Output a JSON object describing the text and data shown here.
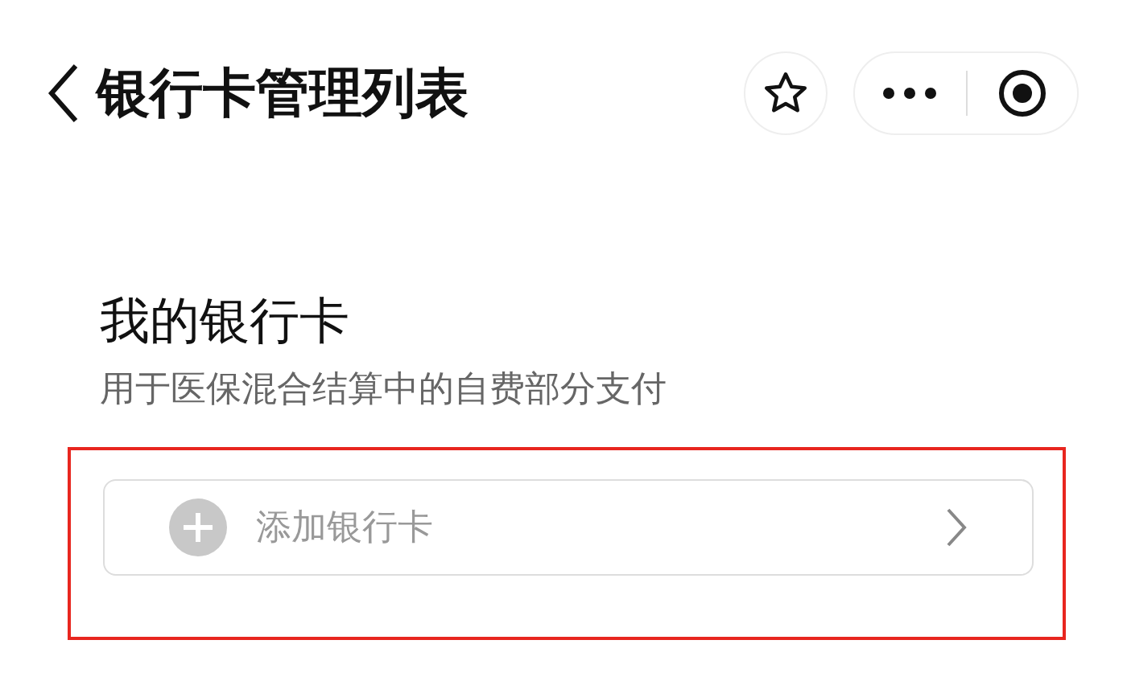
{
  "header": {
    "title": "银行卡管理列表"
  },
  "section": {
    "title": "我的银行卡",
    "subtitle": "用于医保混合结算中的自费部分支付"
  },
  "add_card": {
    "label": "添加银行卡",
    "highlighted": true
  }
}
